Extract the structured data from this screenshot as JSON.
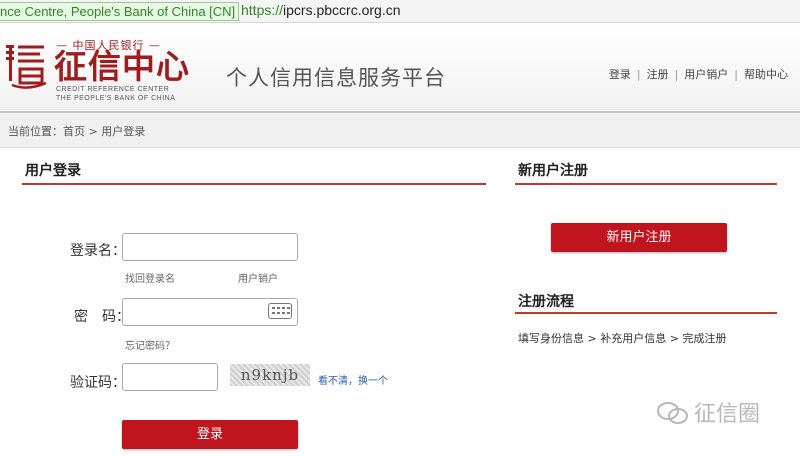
{
  "browser": {
    "cert_label": "nce Centre, People's Bank of China [CN]",
    "url_scheme": "https://",
    "url_host": "ipcrs.pbccrc.org.cn"
  },
  "header": {
    "logo_top": "— 中国人民银行 —",
    "logo_main": "征信中心",
    "logo_en_1": "CREDIT REFERENCE CENTER",
    "logo_en_2": "THE PEOPLE'S BANK OF CHINA",
    "platform_title": "个人信用信息服务平台",
    "nav": [
      "登录",
      "注册",
      "用户销户",
      "帮助中心"
    ],
    "nav_separator": "|"
  },
  "breadcrumb": {
    "text": "当前位置：首页 > 用户登录"
  },
  "login": {
    "title": "用户登录",
    "username_label": "登录名：",
    "find_username": "找回登录名",
    "cancel_user": "用户销户",
    "password_label": "密　码：",
    "forgot_password": "忘记密码？",
    "captcha_label": "验证码：",
    "captcha_text": "n9knjb",
    "refresh_text": "看不清，换一个",
    "submit_label": "登录"
  },
  "register": {
    "title": "新用户注册",
    "button_label": "新用户注册",
    "flow_title": "注册流程",
    "flow_text": "填写身份信息 > 补充用户信息 > 完成注册"
  },
  "watermark": {
    "text": "征信圈"
  },
  "colors": {
    "accent_red": "#c0141e",
    "brand_red": "#a01c1c",
    "secure_green": "#2d8a1f"
  }
}
